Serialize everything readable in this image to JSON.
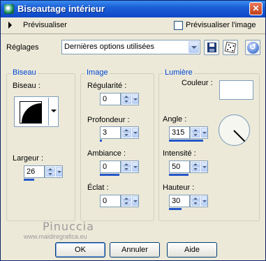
{
  "window": {
    "title": "Biseautage intérieur"
  },
  "toolbar": {
    "preview_label": "Prévisualiser",
    "preview_image_label": "Prévisualiser l'image",
    "preview_image_checked": false
  },
  "settings": {
    "label": "Réglages",
    "selected": "Dernières options utilisées"
  },
  "bevel_group": {
    "title": "Biseau",
    "bevel_label": "Biseau :",
    "width_label": "Largeur :",
    "width_value": "26",
    "width_level": 0.26
  },
  "image_group": {
    "title": "Image",
    "smoothness_label": "Régularité :",
    "smoothness_value": "0",
    "smoothness_level": 0,
    "depth_label": "Profondeur :",
    "depth_value": "3",
    "depth_level": 0.05,
    "ambience_label": "Ambiance :",
    "ambience_value": "0",
    "ambience_level": 0.5,
    "shininess_label": "Éclat :",
    "shininess_value": "0",
    "shininess_level": 0
  },
  "light_group": {
    "title": "Lumière",
    "color_label": "Couleur :",
    "color_value": "#FFFFFF",
    "angle_label": "Angle :",
    "angle_value": "315",
    "angle_level": 0.875,
    "intensity_label": "Intensité :",
    "intensity_value": "50",
    "intensity_level": 0.5,
    "elevation_label": "Hauteur :",
    "elevation_value": "30",
    "elevation_level": 0.33
  },
  "watermark": {
    "main": "Pinuccia",
    "sub": "www.maidiregrafica.eu"
  },
  "buttons": {
    "ok": "OK",
    "cancel": "Annuler",
    "help": "Aide"
  }
}
